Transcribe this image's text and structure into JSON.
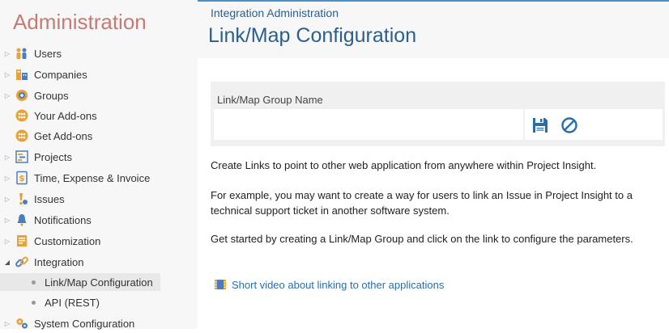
{
  "sidebar": {
    "title": "Administration",
    "items": [
      {
        "label": "Users",
        "icon": "users-icon"
      },
      {
        "label": "Companies",
        "icon": "companies-icon"
      },
      {
        "label": "Groups",
        "icon": "groups-icon"
      },
      {
        "label": "Your Add-ons",
        "icon": "addons-icon"
      },
      {
        "label": "Get Add-ons",
        "icon": "get-addons-icon"
      },
      {
        "label": "Projects",
        "icon": "projects-icon"
      },
      {
        "label": "Time, Expense & Invoice",
        "icon": "time-expense-icon"
      },
      {
        "label": "Issues",
        "icon": "issues-icon"
      },
      {
        "label": "Notifications",
        "icon": "notifications-icon"
      },
      {
        "label": "Customization",
        "icon": "customization-icon"
      },
      {
        "label": "Integration",
        "icon": "integration-icon"
      },
      {
        "label": "System Configuration",
        "icon": "system-config-icon"
      }
    ],
    "sub_items": [
      {
        "label": "Link/Map Configuration",
        "active": true
      },
      {
        "label": "API (REST)",
        "active": false
      }
    ]
  },
  "header": {
    "breadcrumb": "Integration Administration",
    "title": "Link/Map Configuration"
  },
  "group_panel": {
    "label": "Link/Map Group Name",
    "input_value": "",
    "save_icon": "save-icon",
    "cancel_icon": "cancel-icon"
  },
  "content": {
    "para1": "Create Links to point to other web application from anywhere within Project Insight.",
    "para2": "For example, you may want to create a way for users to link an Issue in Project Insight to a technical support ticket in another software system.",
    "para3": "Get started by creating a Link/Map Group and click on the link to configure the parameters.",
    "video_link": "Short video about linking to other applications"
  },
  "colors": {
    "accent": "#2a5f8f",
    "sidebar_title": "#c87a72",
    "link": "#2a6ea8"
  }
}
